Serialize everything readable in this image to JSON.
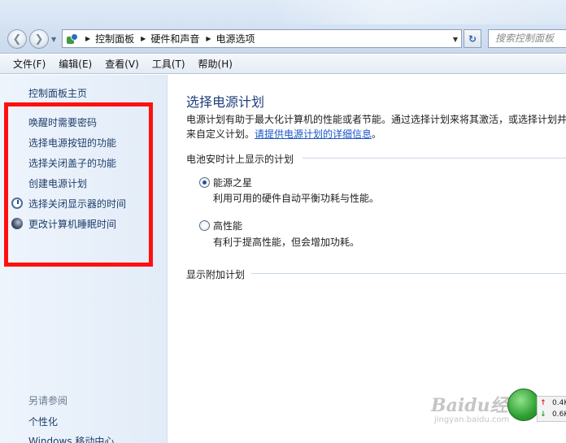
{
  "navigation": {
    "breadcrumbs": [
      "控制面板",
      "硬件和声音",
      "电源选项"
    ],
    "search_placeholder": "搜索控制面板"
  },
  "menu": [
    "文件(F)",
    "编辑(E)",
    "查看(V)",
    "工具(T)",
    "帮助(H)"
  ],
  "sidebar": {
    "home": "控制面板主页",
    "tasks": [
      {
        "label": "唤醒时需要密码",
        "icon": ""
      },
      {
        "label": "选择电源按钮的功能",
        "icon": ""
      },
      {
        "label": "选择关闭盖子的功能",
        "icon": ""
      },
      {
        "label": "创建电源计划",
        "icon": ""
      },
      {
        "label": "选择关闭显示器的时间",
        "icon": "clock-icon"
      },
      {
        "label": "更改计算机睡眠时间",
        "icon": "moon-icon"
      }
    ],
    "see_also": "另请参阅",
    "see_also_items": [
      "个性化",
      "Windows 移动中心"
    ]
  },
  "main": {
    "title": "选择电源计划",
    "description_line1": "电源计划有助于最大化计算机的性能或者节能。通过选择计划来将其激活，或选择计划并",
    "description_line2": "来自定义计划。",
    "detail_link": "请提供电源计划的详细信息",
    "description_end": "。",
    "battery_group": "电池安时计上显示的计划",
    "plans": [
      {
        "name": "能源之星",
        "description": "利用可用的硬件自动平衡功耗与性能。",
        "selected": true
      },
      {
        "name": "高性能",
        "description": "有利于提高性能，但会增加功耗。",
        "selected": false
      }
    ],
    "additional_plans": "显示附加计划"
  },
  "overlay": {
    "watermark": "Baidu经验",
    "watermark_url": "jingyan.baidu.com",
    "upload_speed": "0.4K",
    "download_speed": "0.6K"
  },
  "colors": {
    "highlight_border": "#ff1010",
    "link": "#1a57c5",
    "title": "#1f3e7c"
  }
}
